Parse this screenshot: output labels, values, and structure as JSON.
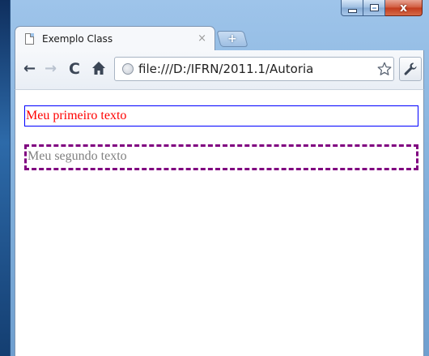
{
  "window": {
    "caption": {
      "minimize_icon": "minimize-icon",
      "maximize_icon": "maximize-icon",
      "close_icon": "close-icon",
      "close_glyph": "x"
    }
  },
  "tab": {
    "title": "Exemplo Class",
    "close_glyph": "×",
    "page_icon": "page-icon"
  },
  "new_tab": {
    "glyph": "+"
  },
  "toolbar": {
    "back_glyph": "←",
    "forward_glyph": "→",
    "reload_glyph": "C",
    "home_icon": "home-icon",
    "url": "file:///D:/IFRN/2011.1/Autoria",
    "bookmark_icon": "star-icon",
    "menu_icon": "wrench-icon"
  },
  "content": {
    "text1": "Meu primeiro texto",
    "text2": "Meu segundo texto"
  },
  "colors": {
    "text1_color": "#ff0000",
    "text1_border": "#0000ff",
    "text2_color": "#808080",
    "text2_border": "#800080"
  }
}
